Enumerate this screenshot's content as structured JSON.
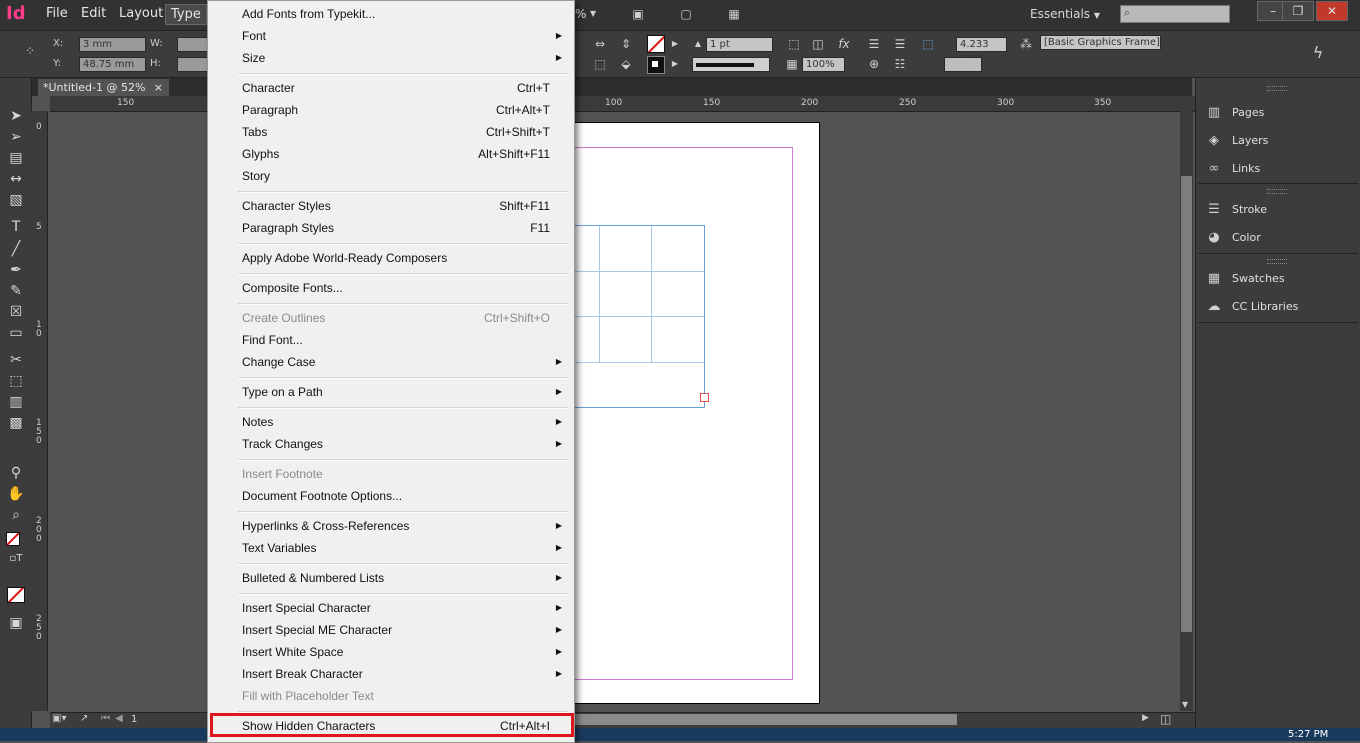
{
  "app": {
    "logo": "Id",
    "menu": [
      "File",
      "Edit",
      "Layout",
      "Type"
    ],
    "active_menu": "Type",
    "workspace": "Essentials",
    "window_controls": [
      "–",
      "❐",
      "✕"
    ]
  },
  "control_bar": {
    "x_label": "X:",
    "y_label": "Y:",
    "w_label": "W:",
    "h_label": "H:",
    "x_value": "3 mm",
    "y_value": "48.75 mm",
    "stroke_weight": "1 pt",
    "opacity": "100%",
    "gap_value": "4.233 mm",
    "object_style": "[Basic Graphics Frame]",
    "zoom_fragment": "%"
  },
  "document": {
    "tab_title": "*Untitled-1 @ 52%",
    "tab_close": "×",
    "page_number": "1"
  },
  "ruler": {
    "h_ticks": [
      "150",
      "100",
      "150",
      "200",
      "250",
      "300",
      "350"
    ],
    "v_ticks": [
      "0",
      "5",
      "1",
      "0",
      "1",
      "5",
      "0",
      "2",
      "0",
      "0",
      "2",
      "5",
      "0"
    ]
  },
  "panels": [
    {
      "label": "Pages",
      "icon": "pages-icon"
    },
    {
      "label": "Layers",
      "icon": "layers-icon"
    },
    {
      "label": "Links",
      "icon": "links-icon"
    },
    {
      "label": "Stroke",
      "icon": "stroke-icon"
    },
    {
      "label": "Color",
      "icon": "color-icon"
    },
    {
      "label": "Swatches",
      "icon": "swatches-icon"
    },
    {
      "label": "CC Libraries",
      "icon": "cc-libraries-icon"
    }
  ],
  "type_menu": [
    {
      "label": "Add Fonts from Typekit...",
      "shortcut": "",
      "submenu": false,
      "disabled": false
    },
    {
      "label": "Font",
      "shortcut": "",
      "submenu": true,
      "disabled": false
    },
    {
      "label": "Size",
      "shortcut": "",
      "submenu": true,
      "disabled": false
    },
    {
      "label": "Character",
      "shortcut": "Ctrl+T",
      "submenu": false,
      "disabled": false
    },
    {
      "label": "Paragraph",
      "shortcut": "Ctrl+Alt+T",
      "submenu": false,
      "disabled": false
    },
    {
      "label": "Tabs",
      "shortcut": "Ctrl+Shift+T",
      "submenu": false,
      "disabled": false
    },
    {
      "label": "Glyphs",
      "shortcut": "Alt+Shift+F11",
      "submenu": false,
      "disabled": false
    },
    {
      "label": "Story",
      "shortcut": "",
      "submenu": false,
      "disabled": false
    },
    {
      "label": "Character Styles",
      "shortcut": "Shift+F11",
      "submenu": false,
      "disabled": false
    },
    {
      "label": "Paragraph Styles",
      "shortcut": "F11",
      "submenu": false,
      "disabled": false
    },
    {
      "label": "Apply Adobe World-Ready Composers",
      "shortcut": "",
      "submenu": false,
      "disabled": false
    },
    {
      "label": "Composite Fonts...",
      "shortcut": "",
      "submenu": false,
      "disabled": false
    },
    {
      "label": "Create Outlines",
      "shortcut": "Ctrl+Shift+O",
      "submenu": false,
      "disabled": true
    },
    {
      "label": "Find Font...",
      "shortcut": "",
      "submenu": false,
      "disabled": false
    },
    {
      "label": "Change Case",
      "shortcut": "",
      "submenu": true,
      "disabled": false
    },
    {
      "label": "Type on a Path",
      "shortcut": "",
      "submenu": true,
      "disabled": false
    },
    {
      "label": "Notes",
      "shortcut": "",
      "submenu": true,
      "disabled": false
    },
    {
      "label": "Track Changes",
      "shortcut": "",
      "submenu": true,
      "disabled": false
    },
    {
      "label": "Insert Footnote",
      "shortcut": "",
      "submenu": false,
      "disabled": true
    },
    {
      "label": "Document Footnote Options...",
      "shortcut": "",
      "submenu": false,
      "disabled": false
    },
    {
      "label": "Hyperlinks & Cross-References",
      "shortcut": "",
      "submenu": true,
      "disabled": false
    },
    {
      "label": "Text Variables",
      "shortcut": "",
      "submenu": true,
      "disabled": false
    },
    {
      "label": "Bulleted & Numbered Lists",
      "shortcut": "",
      "submenu": true,
      "disabled": false
    },
    {
      "label": "Insert Special Character",
      "shortcut": "",
      "submenu": true,
      "disabled": false
    },
    {
      "label": "Insert Special ME Character",
      "shortcut": "",
      "submenu": true,
      "disabled": false
    },
    {
      "label": "Insert White Space",
      "shortcut": "",
      "submenu": true,
      "disabled": false
    },
    {
      "label": "Insert Break Character",
      "shortcut": "",
      "submenu": true,
      "disabled": false
    },
    {
      "label": "Fill with Placeholder Text",
      "shortcut": "",
      "submenu": false,
      "disabled": true
    },
    {
      "label": "Show Hidden Characters",
      "shortcut": "Ctrl+Alt+I",
      "submenu": false,
      "disabled": false
    }
  ],
  "highlight_color": "#e0161e",
  "taskbar_time": "5:27 PM"
}
